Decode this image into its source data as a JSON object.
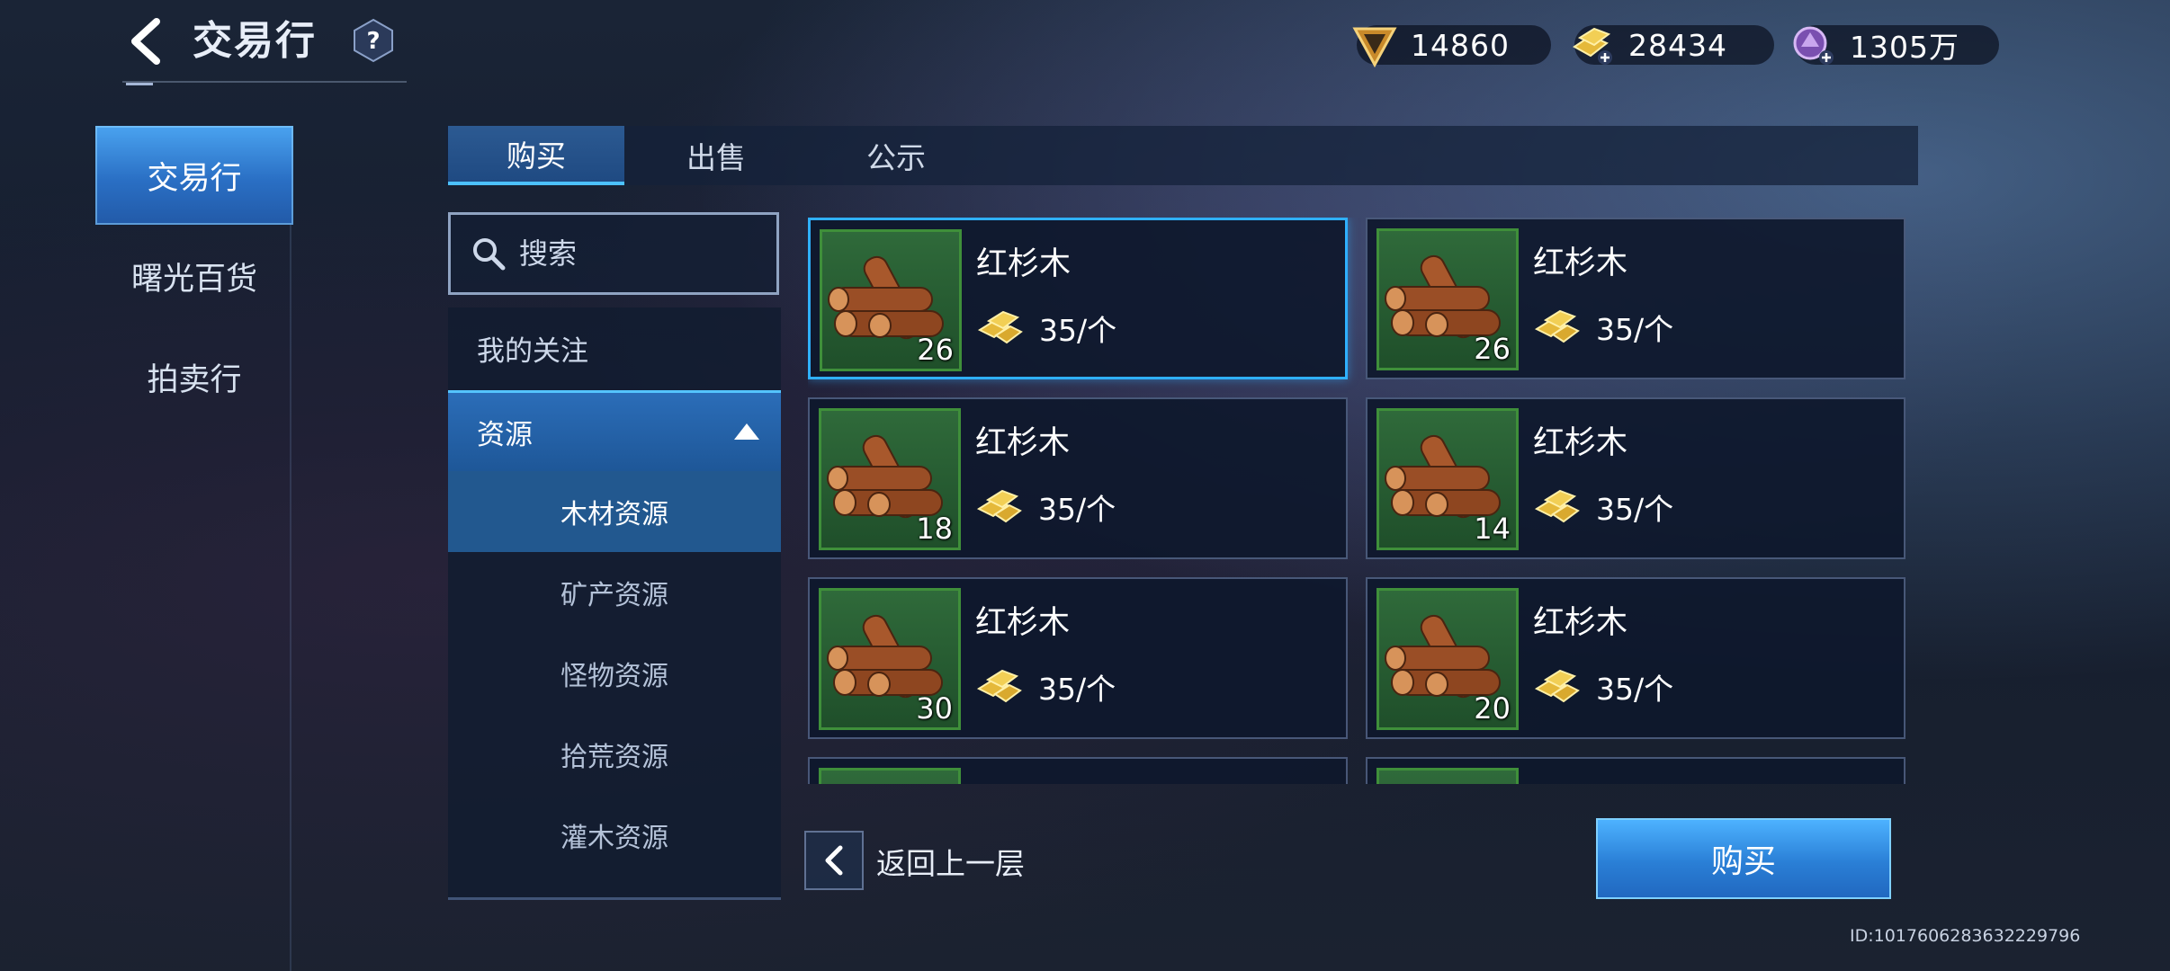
{
  "header": {
    "title": "交易行",
    "help_label": "?"
  },
  "currencies": [
    {
      "name": "triangle-crystal-icon",
      "value": "14860",
      "color": "#d9a33a"
    },
    {
      "name": "gold-bars-add-icon",
      "value": "28434",
      "color": "#e9c44a"
    },
    {
      "name": "purple-gem-add-icon",
      "value": "1305万",
      "color": "#b48ad8"
    }
  ],
  "side_nav": {
    "items": [
      {
        "label": "交易行",
        "active": true
      },
      {
        "label": "曙光百货",
        "active": false
      },
      {
        "label": "拍卖行",
        "active": false
      }
    ]
  },
  "tabs": [
    {
      "label": "购买",
      "active": true
    },
    {
      "label": "出售",
      "active": false
    },
    {
      "label": "公示",
      "active": false
    }
  ],
  "search": {
    "placeholder": "搜索"
  },
  "categories": {
    "favorites": "我的关注",
    "group": "资源",
    "subitems": [
      "木材资源",
      "矿产资源",
      "怪物资源",
      "拾荒资源",
      "灌木资源"
    ],
    "active_sub": "木材资源"
  },
  "listings": [
    {
      "name": "红杉木",
      "qty": "26",
      "price": "35/个",
      "selected": true
    },
    {
      "name": "红杉木",
      "qty": "26",
      "price": "35/个",
      "selected": false
    },
    {
      "name": "红杉木",
      "qty": "18",
      "price": "35/个",
      "selected": false
    },
    {
      "name": "红杉木",
      "qty": "14",
      "price": "35/个",
      "selected": false
    },
    {
      "name": "红杉木",
      "qty": "30",
      "price": "35/个",
      "selected": false
    },
    {
      "name": "红杉木",
      "qty": "20",
      "price": "35/个",
      "selected": false
    }
  ],
  "footer": {
    "back_label": "返回上一层",
    "buy_label": "购买",
    "user_id": "ID:1017606283632229796"
  }
}
